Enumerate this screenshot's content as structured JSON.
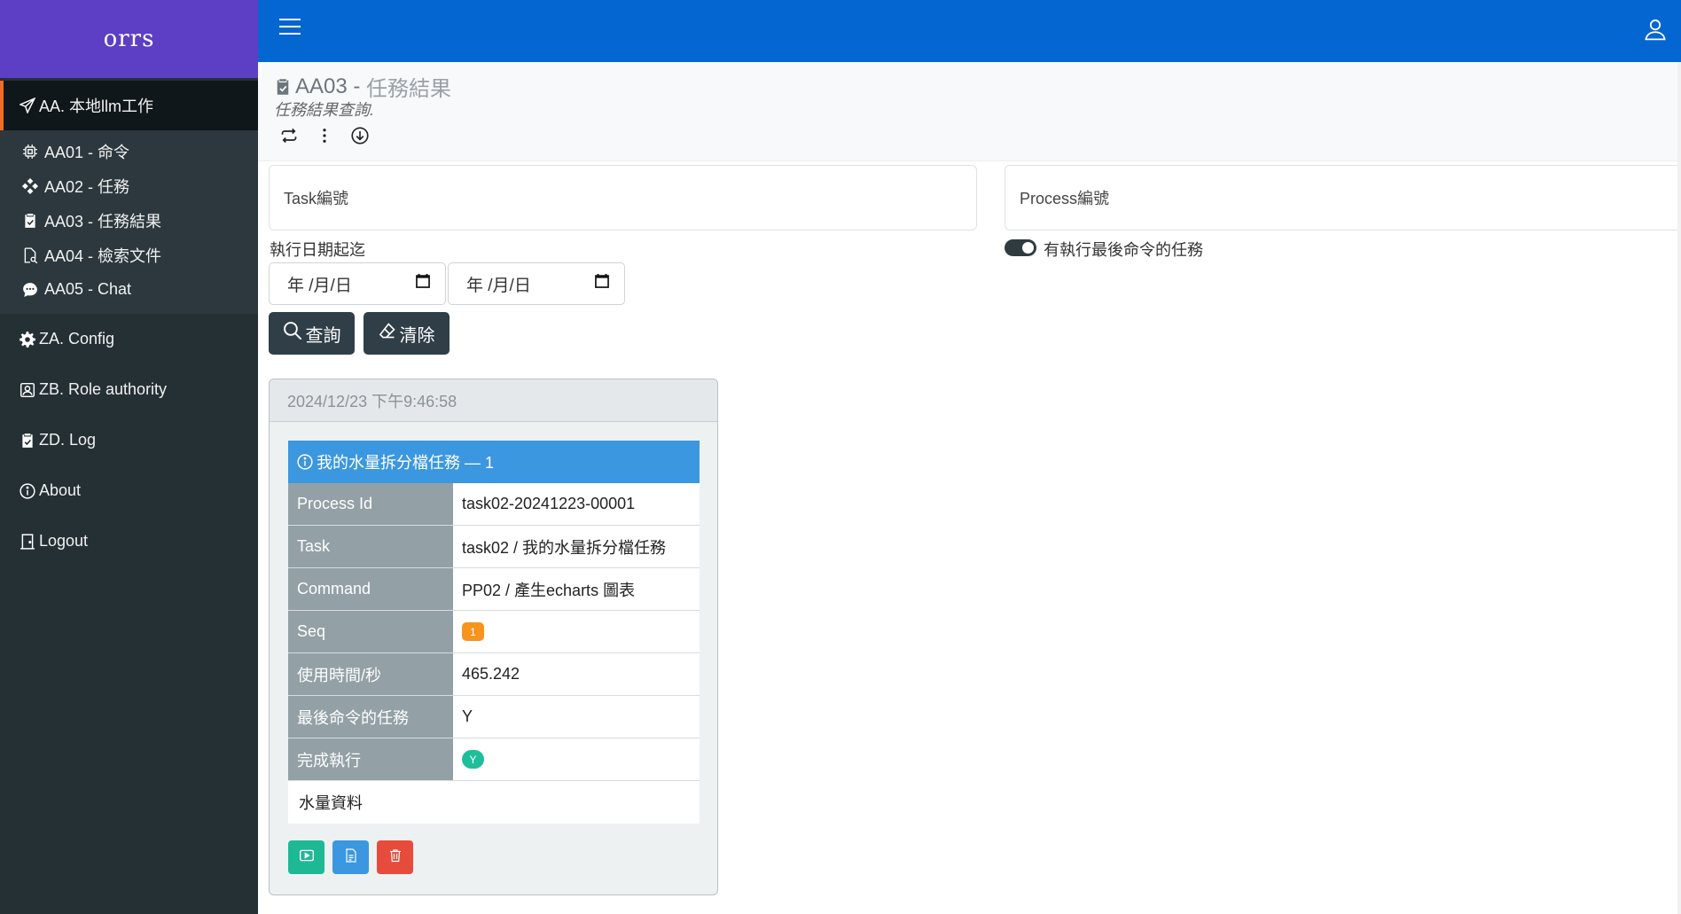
{
  "brand": "orrs",
  "sidebar": {
    "groups": [
      {
        "label": "AA. 本地llm工作",
        "icon": "paper-plane-icon",
        "active": true,
        "items": [
          {
            "label": "AA01 - 命令",
            "icon": "cpu-icon"
          },
          {
            "label": "AA02 - 任務",
            "icon": "diamond-cluster-icon"
          },
          {
            "label": "AA03 - 任務結果",
            "icon": "clipboard-check-icon"
          },
          {
            "label": "AA04 - 檢索文件",
            "icon": "file-search-icon"
          },
          {
            "label": "AA05 - Chat",
            "icon": "chat-bubble-icon"
          }
        ]
      },
      {
        "label": "ZA. Config",
        "icon": "gear-icon"
      },
      {
        "label": "ZB. Role authority",
        "icon": "person-badge-icon"
      },
      {
        "label": "ZD. Log",
        "icon": "clipboard-icon"
      },
      {
        "label": "About",
        "icon": "info-circle-icon"
      },
      {
        "label": "Logout",
        "icon": "door-icon"
      }
    ]
  },
  "page": {
    "code": "AA03",
    "separator": " - ",
    "name": "任務結果",
    "subtitle": "任務結果查詢."
  },
  "filters": {
    "task_placeholder": "Task編號",
    "process_placeholder": "Process編號",
    "date_label": "執行日期起迄",
    "date_from": "年 /月/日",
    "date_to": "年 /月/日",
    "toggle_label": "有執行最後命令的任務",
    "search_label": "查詢",
    "clear_label": "清除"
  },
  "result": {
    "timestamp": "2024/12/23 下午9:46:58",
    "title": "我的水量拆分檔任務 — 1",
    "rows": [
      {
        "key": "Process Id",
        "value": "task02-20241223-00001"
      },
      {
        "key": "Task",
        "value": "task02 / 我的水量拆分檔任務"
      },
      {
        "key": "Command",
        "value": "PP02 / 產生echarts 圖表"
      },
      {
        "key": "Seq",
        "value": "1"
      },
      {
        "key": "使用時間/秒",
        "value": "465.242"
      },
      {
        "key": "最後命令的任務",
        "value": "Y"
      },
      {
        "key": "完成執行",
        "value": "Y"
      }
    ],
    "note": "水量資料"
  },
  "colors": {
    "brand_bg": "#5c3fc4",
    "topbar_bg": "#0466d0",
    "sidebar_bg": "#253035",
    "active_accent": "#f26b20",
    "detail_header": "#3b97df",
    "badge_orange": "#f7941d",
    "badge_green": "#1fbe9a",
    "btn_red": "#e64c3c"
  }
}
